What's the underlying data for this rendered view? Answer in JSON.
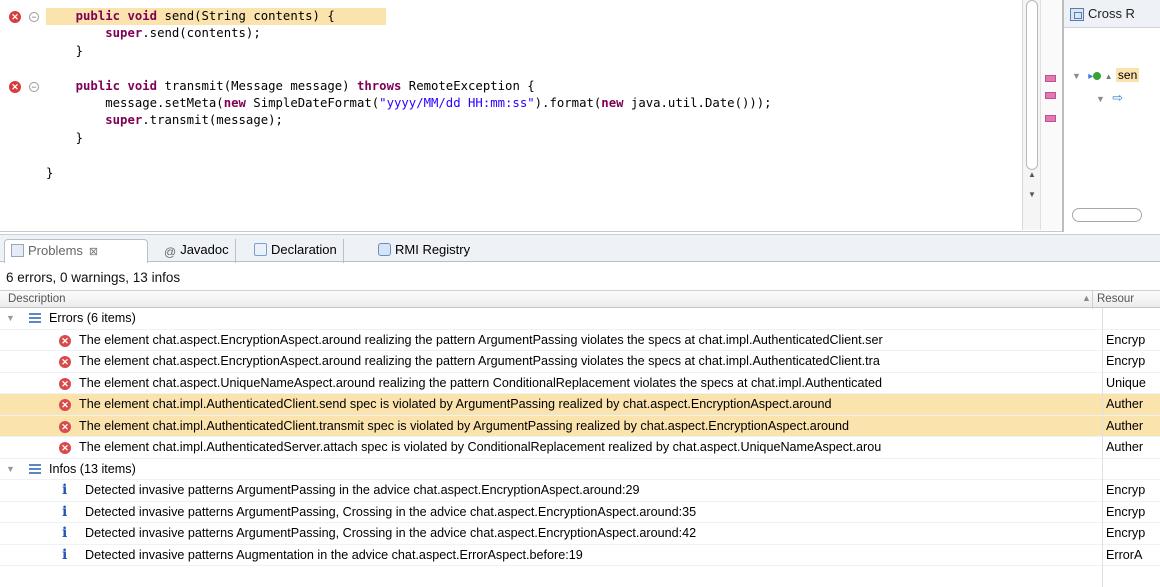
{
  "editor": {
    "lines": [
      {
        "tokens": [
          {
            "t": "    ",
            "k": ""
          },
          {
            "t": "public",
            "k": "kw"
          },
          {
            "t": " ",
            "k": ""
          },
          {
            "t": "void",
            "k": "kw"
          },
          {
            "t": " send(String contents) {",
            "k": ""
          }
        ],
        "highlight": true,
        "error": true,
        "fold": true
      },
      {
        "tokens": [
          {
            "t": "        ",
            "k": ""
          },
          {
            "t": "super",
            "k": "kw"
          },
          {
            "t": ".send(contents);",
            "k": ""
          }
        ]
      },
      {
        "tokens": [
          {
            "t": "    }",
            "k": ""
          }
        ]
      },
      {
        "tokens": [
          {
            "t": "",
            "k": ""
          }
        ]
      },
      {
        "tokens": [
          {
            "t": "    ",
            "k": ""
          },
          {
            "t": "public",
            "k": "kw"
          },
          {
            "t": " ",
            "k": ""
          },
          {
            "t": "void",
            "k": "kw"
          },
          {
            "t": " transmit(Message message) ",
            "k": ""
          },
          {
            "t": "throws",
            "k": "kw"
          },
          {
            "t": " RemoteException {",
            "k": ""
          }
        ],
        "error": true,
        "fold": true
      },
      {
        "tokens": [
          {
            "t": "        message.setMeta(",
            "k": ""
          },
          {
            "t": "new",
            "k": "kw"
          },
          {
            "t": " SimpleDateFormat(",
            "k": ""
          },
          {
            "t": "\"yyyy/MM/dd HH:mm:ss\"",
            "k": "str"
          },
          {
            "t": ").format(",
            "k": ""
          },
          {
            "t": "new",
            "k": "kw"
          },
          {
            "t": " java.util.Date()));",
            "k": ""
          }
        ]
      },
      {
        "tokens": [
          {
            "t": "        ",
            "k": ""
          },
          {
            "t": "super",
            "k": "kw"
          },
          {
            "t": ".transmit(message);",
            "k": ""
          }
        ]
      },
      {
        "tokens": [
          {
            "t": "    }",
            "k": ""
          }
        ]
      },
      {
        "tokens": [
          {
            "t": "",
            "k": ""
          }
        ]
      },
      {
        "tokens": [
          {
            "t": "}",
            "k": ""
          }
        ]
      }
    ],
    "error_marker_glyph": "✕",
    "fold_glyph": "−"
  },
  "xref": {
    "title": "Cross R",
    "tree_item1": "sen",
    "tree_item2_icon": "⇨"
  },
  "tabs": [
    {
      "label": "Problems",
      "icon": "problems-icon",
      "active": true,
      "close": "⊠"
    },
    {
      "label": "Javadoc",
      "icon": "at-icon",
      "prefix": "@"
    },
    {
      "label": "Declaration",
      "icon": "declaration-icon"
    },
    {
      "label": "RMI Registry",
      "icon": "rmi-registry-icon"
    }
  ],
  "problems": {
    "summary": "6 errors, 0 warnings, 13 infos",
    "columns": {
      "description": "Description",
      "resource": "Resour"
    },
    "groups": {
      "errors": "Errors (6 items)",
      "infos": "Infos (13 items)"
    },
    "errors": [
      {
        "text": "The element chat.aspect.EncryptionAspect.around realizing the pattern ArgumentPassing violates the specs at chat.impl.AuthenticatedClient.ser",
        "resource": "Encryp",
        "highlight": false
      },
      {
        "text": "The element chat.aspect.EncryptionAspect.around realizing the pattern ArgumentPassing violates the specs at chat.impl.AuthenticatedClient.tra",
        "resource": "Encryp",
        "highlight": false
      },
      {
        "text": "The element chat.aspect.UniqueNameAspect.around realizing the pattern ConditionalReplacement violates the specs at chat.impl.Authenticated",
        "resource": "Unique",
        "highlight": false
      },
      {
        "text": "The element chat.impl.AuthenticatedClient.send spec is violated by ArgumentPassing realized by chat.aspect.EncryptionAspect.around",
        "resource": "Auther",
        "highlight": true
      },
      {
        "text": "The element chat.impl.AuthenticatedClient.transmit spec is violated by ArgumentPassing realized by chat.aspect.EncryptionAspect.around",
        "resource": "Auther",
        "highlight": true
      },
      {
        "text": "The element chat.impl.AuthenticatedServer.attach spec is violated by ConditionalReplacement realized by chat.aspect.UniqueNameAspect.arou",
        "resource": "Auther",
        "highlight": false
      }
    ],
    "infos": [
      {
        "text": "Detected invasive patterns ArgumentPassing in the advice chat.aspect.EncryptionAspect.around:29",
        "resource": "Encryp"
      },
      {
        "text": "Detected invasive patterns ArgumentPassing, Crossing in the advice chat.aspect.EncryptionAspect.around:35",
        "resource": "Encryp"
      },
      {
        "text": "Detected invasive patterns ArgumentPassing, Crossing in the advice chat.aspect.EncryptionAspect.around:42",
        "resource": "Encryp"
      },
      {
        "text": "Detected invasive patterns Augmentation in the advice chat.aspect.ErrorAspect.before:19",
        "resource": "ErrorA"
      }
    ],
    "error_icon_glyph": "✕",
    "info_icon_glyph": "i",
    "expand_glyph": "▼"
  },
  "colors": {
    "highlight": "#fbe3ad",
    "keyword": "#7f0055",
    "string": "#2a00ff",
    "error": "#d94a4a",
    "info": "#2456b8"
  }
}
